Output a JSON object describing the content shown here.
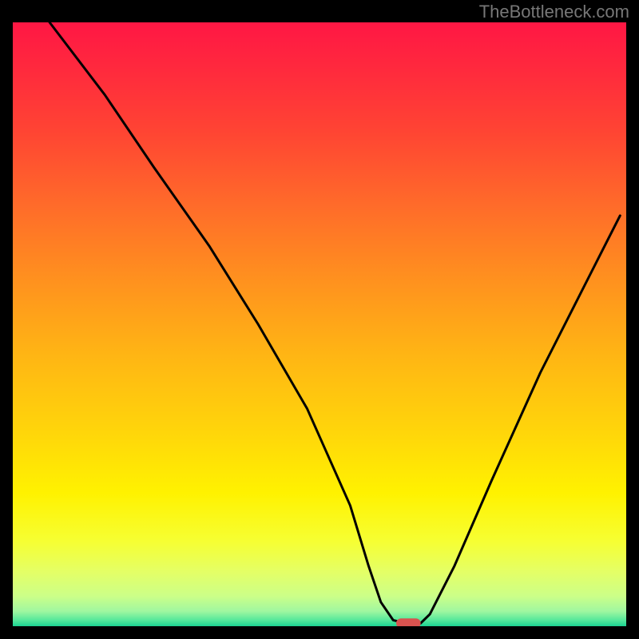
{
  "watermark": "TheBottleneck.com",
  "chart_data": {
    "type": "line",
    "title": "",
    "xlabel": "",
    "ylabel": "",
    "xlim": [
      0,
      100
    ],
    "ylim": [
      0,
      100
    ],
    "grid": false,
    "legend": false,
    "gradient_stops": [
      {
        "offset": 0.0,
        "color": "#ff1744"
      },
      {
        "offset": 0.08,
        "color": "#ff2a3d"
      },
      {
        "offset": 0.18,
        "color": "#ff4433"
      },
      {
        "offset": 0.3,
        "color": "#ff6a2a"
      },
      {
        "offset": 0.42,
        "color": "#ff8f1f"
      },
      {
        "offset": 0.55,
        "color": "#ffb514"
      },
      {
        "offset": 0.68,
        "color": "#ffd60a"
      },
      {
        "offset": 0.78,
        "color": "#fff200"
      },
      {
        "offset": 0.86,
        "color": "#f6ff33"
      },
      {
        "offset": 0.91,
        "color": "#e4ff66"
      },
      {
        "offset": 0.95,
        "color": "#ccff88"
      },
      {
        "offset": 0.975,
        "color": "#a0f7a0"
      },
      {
        "offset": 0.99,
        "color": "#55e89b"
      },
      {
        "offset": 1.0,
        "color": "#1bd392"
      }
    ],
    "series": [
      {
        "name": "bottleneck-curve",
        "color": "#000000",
        "x": [
          6,
          15,
          23,
          32,
          40,
          48,
          55,
          58,
          60,
          62,
          64,
          66.5,
          68,
          72,
          78,
          86,
          94,
          99
        ],
        "y": [
          100,
          88,
          76,
          63,
          50,
          36,
          20,
          10,
          4,
          1,
          0.5,
          0.5,
          2,
          10,
          24,
          42,
          58,
          68
        ]
      }
    ],
    "marker": {
      "name": "optimal-marker",
      "color": "#d9534f",
      "x_range": [
        62.5,
        66.5
      ],
      "y": 0.5
    }
  }
}
